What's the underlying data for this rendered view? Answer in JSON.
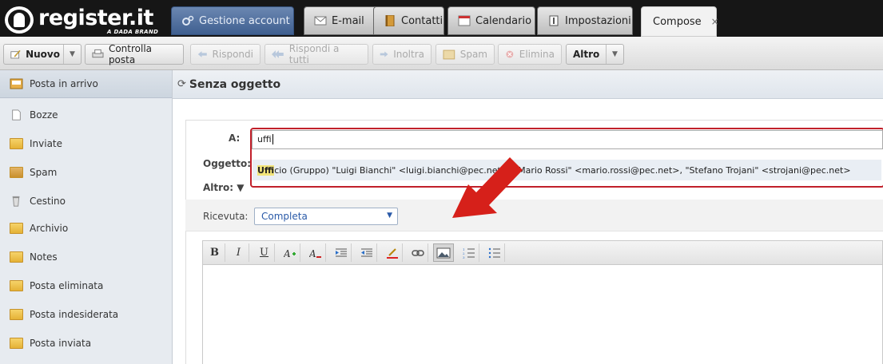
{
  "brand": {
    "name": "register.it",
    "subtitle": "A DADA BRAND"
  },
  "tabs": [
    {
      "label": "Gestione account",
      "icon": "gears-icon"
    },
    {
      "label": "E-mail",
      "icon": "envelope-icon"
    },
    {
      "label": "Contatti",
      "icon": "address-book-icon"
    },
    {
      "label": "Calendario",
      "icon": "calendar-icon"
    },
    {
      "label": "Impostazioni",
      "icon": "settings-icon"
    },
    {
      "label": "Compose",
      "close": "×"
    }
  ],
  "toolbar": {
    "new": "Nuovo",
    "check": "Controlla posta",
    "reply": "Rispondi",
    "reply_all": "Rispondi a tutti",
    "forward": "Inoltra",
    "spam": "Spam",
    "delete": "Elimina",
    "more": "Altro"
  },
  "sidebar": {
    "items": [
      {
        "label": "Posta in arrivo",
        "icon": "inbox-icon",
        "active": true
      },
      {
        "label": "Bozze",
        "icon": "draft-icon"
      },
      {
        "label": "Inviate",
        "icon": "sent-folder-icon"
      },
      {
        "label": "Spam",
        "icon": "spam-folder-icon"
      },
      {
        "label": "Cestino",
        "icon": "trash-icon"
      },
      {
        "label": "Archivio",
        "icon": "folder-icon"
      },
      {
        "label": "Notes",
        "icon": "folder-icon"
      },
      {
        "label": "Posta eliminata",
        "icon": "folder-icon"
      },
      {
        "label": "Posta indesiderata",
        "icon": "folder-icon"
      },
      {
        "label": "Posta inviata",
        "icon": "folder-icon"
      }
    ]
  },
  "compose": {
    "title": "Senza oggetto",
    "to_label": "A:",
    "to_value": "uffi",
    "subject_label": "Oggetto:",
    "more_label": "Altro: ▼",
    "suggestion_match": "Uffi",
    "suggestion_rest": "cio (Gruppo) \"Luigi Bianchi\" <luigi.bianchi@pec.net>, \"Mario Rossi\" <mario.rossi@pec.net>, \"Stefano Trojani\" <strojani@pec.net>",
    "receipt_label": "Ricevuta:",
    "receipt_value": "Completa"
  },
  "editor_toolbar": [
    "B",
    "I",
    "U",
    "font-color-plus-icon",
    "clear-format-icon",
    "outdent-icon",
    "indent-icon",
    "highlight-icon",
    "link-icon",
    "image-icon",
    "ordered-list-icon",
    "unordered-list-icon"
  ],
  "colors": {
    "accent_red": "#c1202a",
    "tab_blue": "#4a6a9c",
    "highlight": "#f2e47a"
  }
}
